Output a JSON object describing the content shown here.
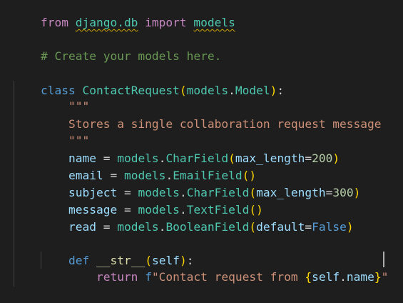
{
  "editor": {
    "lines": {
      "l1": {
        "kw_from": "from",
        "module": "django.db",
        "kw_import": "import",
        "name": "models"
      },
      "l3": {
        "comment": "# Create your models here."
      },
      "l5": {
        "kw_class": "class",
        "class_name": "ContactRequest",
        "open": "(",
        "base_mod": "models",
        "dot": ".",
        "base_cls": "Model",
        "close": ")",
        "colon": ":"
      },
      "l6": {
        "doc": "\"\"\""
      },
      "l7": {
        "doc": "Stores a single collaboration request message"
      },
      "l8": {
        "doc": "\"\"\""
      },
      "l9": {
        "var": "name",
        "eq": " = ",
        "mod": "models",
        "dot": ".",
        "cls": "CharField",
        "open": "(",
        "param": "max_length",
        "peq": "=",
        "num": "200",
        "close": ")"
      },
      "l10": {
        "var": "email",
        "eq": " = ",
        "mod": "models",
        "dot": ".",
        "cls": "EmailField",
        "open": "(",
        "close": ")"
      },
      "l11": {
        "var": "subject",
        "eq": " = ",
        "mod": "models",
        "dot": ".",
        "cls": "CharField",
        "open": "(",
        "param": "max_length",
        "peq": "=",
        "num": "300",
        "close": ")"
      },
      "l12": {
        "var": "message",
        "eq": " = ",
        "mod": "models",
        "dot": ".",
        "cls": "TextField",
        "open": "(",
        "close": ")"
      },
      "l13": {
        "var": "read",
        "eq": " = ",
        "mod": "models",
        "dot": ".",
        "cls": "BooleanField",
        "open": "(",
        "param": "default",
        "peq": "=",
        "kwval": "False",
        "close": ")"
      },
      "l15": {
        "kw_def": "def",
        "fn": "__str__",
        "open": "(",
        "param": "self",
        "close": ")",
        "colon": ":"
      },
      "l16": {
        "kw_return": "return",
        "f": "f",
        "str_open": "\"Contact request from ",
        "brace_open": "{",
        "self": "self",
        "dot": ".",
        "attr": "name",
        "brace_close": "}",
        "str_close": "\""
      }
    }
  }
}
